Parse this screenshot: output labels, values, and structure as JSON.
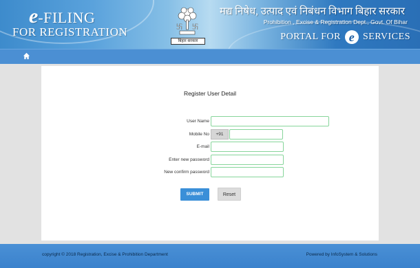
{
  "header": {
    "logo": {
      "e_letter": "e",
      "word": "-FILING",
      "subtitle": "FOR REGISTRATION"
    },
    "emblem_label": "बिहार सरकार",
    "hindi_title": "मद्य निषेध, उत्पाद एवं निबंधन विभाग बिहार सरकार",
    "department": "Prohibition , Excise & Registration Dept., Govt. Of Bihar",
    "portal": {
      "prefix": "PORTAL FOR",
      "e_letter": "e",
      "suffix": "SERVICES"
    }
  },
  "nav": {
    "home_icon": "home-icon"
  },
  "form": {
    "title": "Register User Detail",
    "fields": {
      "username": {
        "label": "User Name",
        "value": ""
      },
      "mobile": {
        "label": "Mobile No",
        "prefix": "+91",
        "value": ""
      },
      "email": {
        "label": "E-mail",
        "value": ""
      },
      "new_password": {
        "label": "Enter new password",
        "value": ""
      },
      "confirm_password": {
        "label": "New confirm password",
        "value": ""
      }
    },
    "submit_label": "SUBMIT",
    "reset_label": "Reset"
  },
  "footer": {
    "copyright": "copyright © 2018 Registration, Excise & Prohibition Department",
    "powered_by": "Powered by InfoSystem & Solutions"
  },
  "colors": {
    "nav_bar": "#4b8fd3",
    "submit_button": "#3a8fd8",
    "input_border": "#86d59a",
    "footer": "#3b82cc"
  }
}
